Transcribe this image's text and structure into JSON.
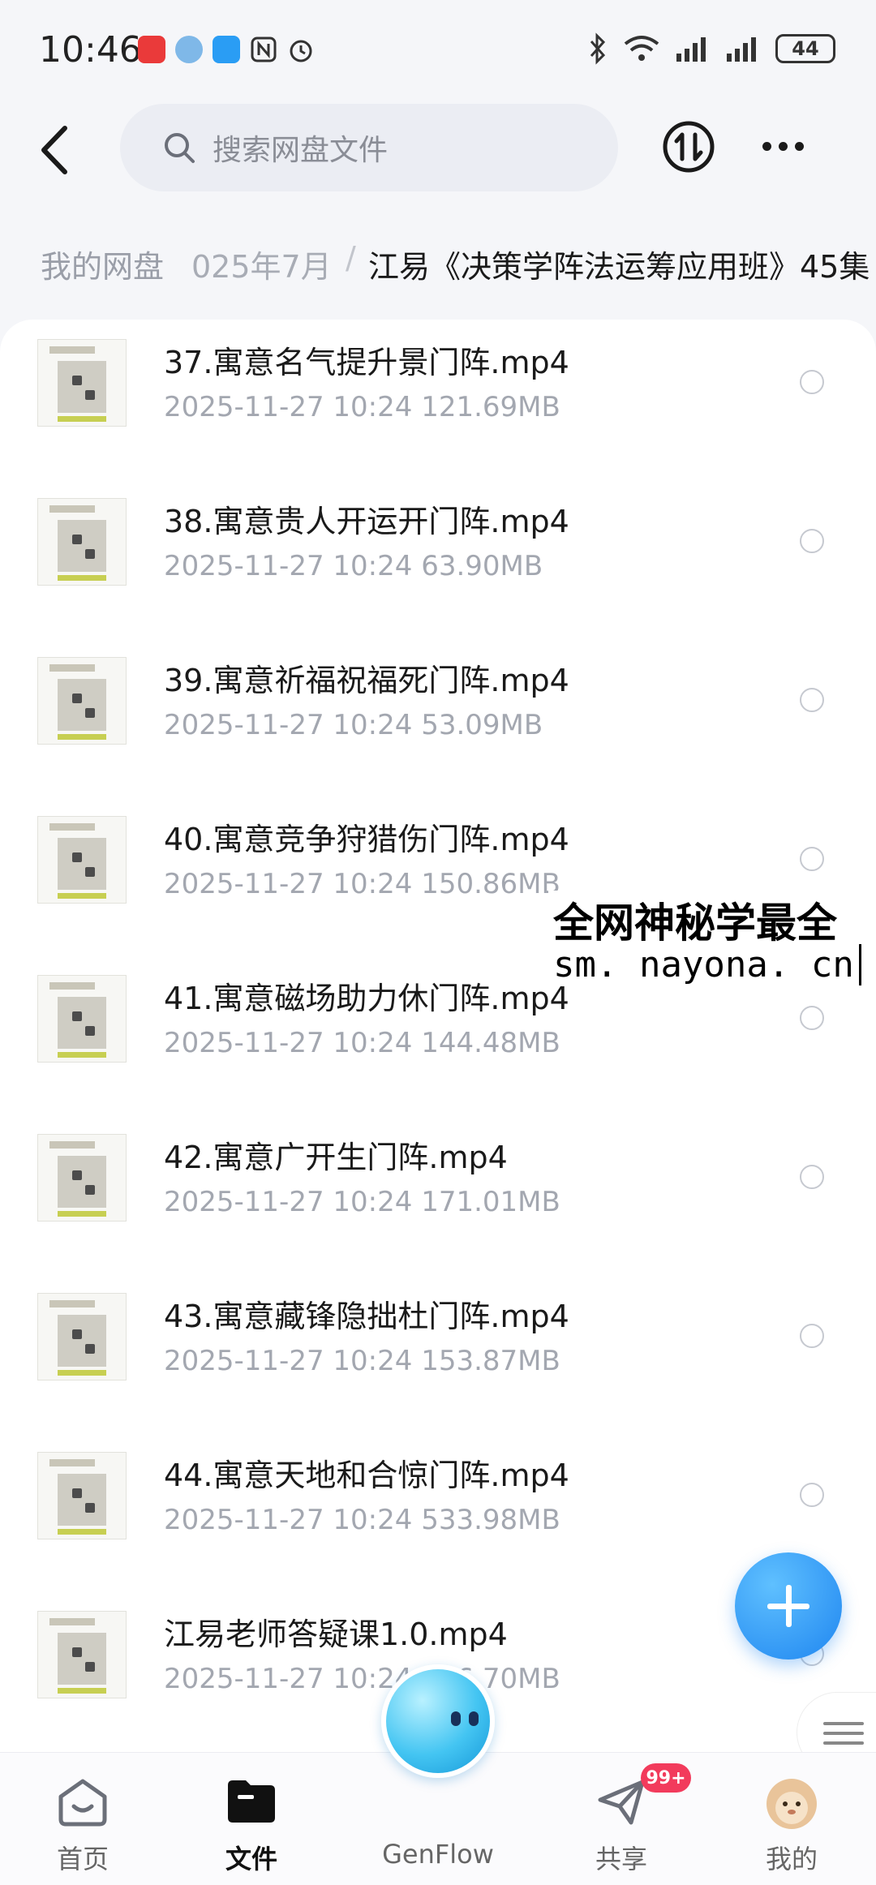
{
  "status_bar": {
    "time": "10:46",
    "battery": "44"
  },
  "header": {
    "search_placeholder": "搜索网盘文件"
  },
  "breadcrumb": {
    "root": "我的网盘",
    "middle": "025年7月",
    "separator": "/",
    "current": "江易《决策学阵法运筹应用班》45集"
  },
  "files": [
    {
      "name": "37.寓意名气提升景门阵.mp4",
      "meta": "2025-11-27  10:24  121.69MB"
    },
    {
      "name": "38.寓意贵人开运开门阵.mp4",
      "meta": "2025-11-27  10:24  63.90MB"
    },
    {
      "name": "39.寓意祈福祝福死门阵.mp4",
      "meta": "2025-11-27  10:24  53.09MB"
    },
    {
      "name": "40.寓意竞争狩猎伤门阵.mp4",
      "meta": "2025-11-27  10:24  150.86MB"
    },
    {
      "name": "41.寓意磁场助力休门阵.mp4",
      "meta": "2025-11-27  10:24  144.48MB"
    },
    {
      "name": "42.寓意广开生门阵.mp4",
      "meta": "2025-11-27  10:24  171.01MB"
    },
    {
      "name": "43.寓意藏锋隐拙杜门阵.mp4",
      "meta": "2025-11-27  10:24  153.87MB"
    },
    {
      "name": "44.寓意天地和合惊门阵.mp4",
      "meta": "2025-11-27  10:24  533.98MB"
    },
    {
      "name": "江易老师答疑课1.0.mp4",
      "meta": "2025-11-27  10:24  706.70MB"
    }
  ],
  "watermark": {
    "line1": "全网神秘学最全",
    "line2": "sm. nayona. cn"
  },
  "nav": {
    "home": "首页",
    "files": "文件",
    "genflow": "GenFlow",
    "share": "共享",
    "me": "我的",
    "share_badge": "99+"
  },
  "colors": {
    "accent": "#1f86f0",
    "badge": "#f23b5c"
  }
}
